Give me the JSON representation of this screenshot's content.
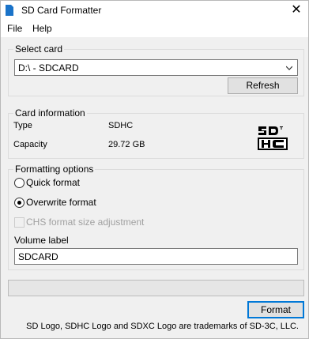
{
  "window": {
    "title": "SD Card Formatter",
    "close_glyph": "✕"
  },
  "menu": {
    "items": [
      {
        "label": "File"
      },
      {
        "label": "Help"
      }
    ]
  },
  "select_card": {
    "group_title": "Select card",
    "selected": "D:\\ - SDCARD",
    "refresh_label": "Refresh"
  },
  "card_info": {
    "group_title": "Card information",
    "type_label": "Type",
    "type_value": "SDHC",
    "capacity_label": "Capacity",
    "capacity_value": "29.72 GB",
    "logo_name": "sdhc-logo"
  },
  "formatting": {
    "group_title": "Formatting options",
    "quick_label": "Quick format",
    "overwrite_label": "Overwrite format",
    "selected_option": "overwrite",
    "chs_label": "CHS format size adjustment",
    "chs_enabled": false,
    "volume_label_caption": "Volume label",
    "volume_label_value": "SDCARD"
  },
  "progress": {
    "fraction": 0
  },
  "actions": {
    "format_label": "Format"
  },
  "footer": {
    "trademark_text": "SD Logo, SDHC Logo and SDXC Logo are trademarks of SD-3C, LLC."
  },
  "colors": {
    "accent": "#0078d7",
    "progress_fill": "#06b025",
    "app_icon": "#1a73c9"
  }
}
